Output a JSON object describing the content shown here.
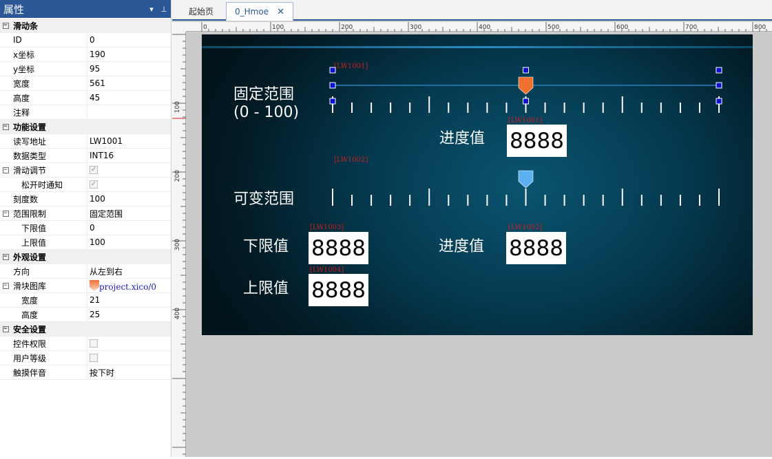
{
  "panel": {
    "title": "属性",
    "dropdown_icon": "▾",
    "pin_icon": "⊥"
  },
  "properties": [
    {
      "type": "cat",
      "name": "滑动条",
      "expander": "−"
    },
    {
      "type": "prop",
      "name": "ID",
      "value": "0"
    },
    {
      "type": "prop",
      "name": "x坐标",
      "value": "190"
    },
    {
      "type": "prop",
      "name": "y坐标",
      "value": "95"
    },
    {
      "type": "prop",
      "name": "宽度",
      "value": "561"
    },
    {
      "type": "prop",
      "name": "高度",
      "value": "45"
    },
    {
      "type": "prop",
      "name": "注释",
      "value": ""
    },
    {
      "type": "cat",
      "name": "功能设置",
      "expander": "−"
    },
    {
      "type": "prop",
      "name": "读写地址",
      "value": "LW1001"
    },
    {
      "type": "prop",
      "name": "数据类型",
      "value": "INT16"
    },
    {
      "type": "prop",
      "name": "滑动调节",
      "expander": "−",
      "check": "✓"
    },
    {
      "type": "prop",
      "name": "松开时通知",
      "indent": 2,
      "check": "✓"
    },
    {
      "type": "prop",
      "name": "刻度数",
      "value": "100"
    },
    {
      "type": "prop",
      "name": "范围限制",
      "expander": "−",
      "value": "固定范围"
    },
    {
      "type": "prop",
      "name": "下限值",
      "indent": 2,
      "value": "0"
    },
    {
      "type": "prop",
      "name": "上限值",
      "indent": 2,
      "value": "100"
    },
    {
      "type": "cat",
      "name": "外观设置",
      "expander": "−"
    },
    {
      "type": "prop",
      "name": "方向",
      "value": "从左到右"
    },
    {
      "type": "prop",
      "name": "滑块图库",
      "expander": "−",
      "link": "project.xico/0"
    },
    {
      "type": "prop",
      "name": "宽度",
      "indent": 2,
      "value": "21"
    },
    {
      "type": "prop",
      "name": "高度",
      "indent": 2,
      "value": "25"
    },
    {
      "type": "cat",
      "name": "安全设置",
      "expander": "−"
    },
    {
      "type": "prop",
      "name": "控件权限",
      "check": ""
    },
    {
      "type": "prop",
      "name": "用户等级",
      "check": ""
    },
    {
      "type": "prop",
      "name": "触摸伴音",
      "value": "按下时"
    }
  ],
  "tabs": [
    {
      "label": "起始页",
      "active": false
    },
    {
      "label": "0_Hmoe",
      "active": true,
      "close": "✕"
    }
  ],
  "ruler": {
    "top_labels": [
      "0",
      "100",
      "200",
      "300",
      "400",
      "500",
      "600",
      "700",
      "800"
    ],
    "left_labels": [
      "100",
      "200",
      "300",
      "400"
    ]
  },
  "screen": {
    "fixed_range_label": "固定范围",
    "fixed_range_sub": "(0 - 100)",
    "variable_range_label": "可变范围",
    "progress_label_1": "进度值",
    "progress_label_2": "进度值",
    "lower_label": "下限值",
    "upper_label": "上限值",
    "tags": {
      "slider1": "[LW1001]",
      "progress1": "[LW1001]",
      "slider2": "[LW1002]",
      "lower": "[LW1003]",
      "progress2": "[LW1002]",
      "upper": "[LW1004]"
    },
    "display_value": "8888",
    "slider1_position": 0.5,
    "slider2_position": 0.5,
    "tick_count": 21,
    "colors": {
      "slider1_handle": "#f07030",
      "slider2_handle": "#5ab0f0",
      "selection_handle": "#1010d0",
      "tag_text": "#cc1f1f"
    }
  }
}
